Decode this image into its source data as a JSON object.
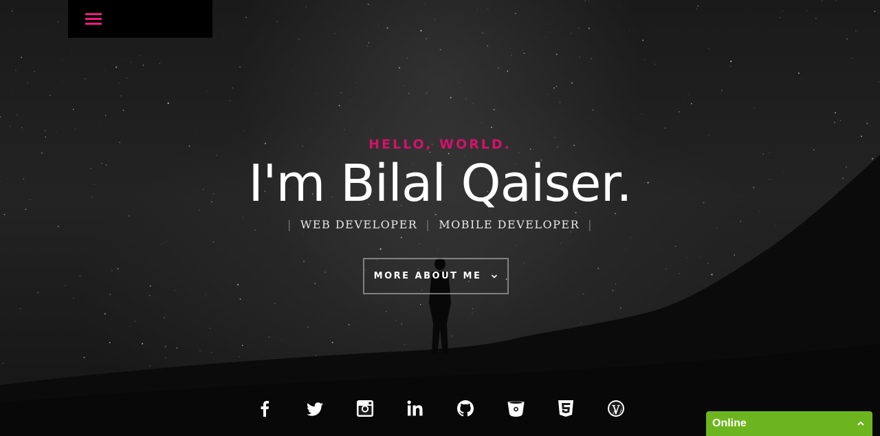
{
  "header": {
    "menu_icon": "hamburger-menu-icon",
    "accent_color": "#ee1a7c"
  },
  "hero": {
    "kicker": "HELLO, WORLD.",
    "headline": "I'm Bilal Qaiser.",
    "roles": [
      "WEB DEVELOPER",
      "MOBILE DEVELOPER"
    ],
    "roles_separator": "|",
    "cta_label": "MORE ABOUT ME",
    "cta_icon": "chevron-down-icon",
    "kicker_color": "#d4126a"
  },
  "social": {
    "icons": [
      "facebook-icon",
      "twitter-icon",
      "instagram-icon",
      "linkedin-icon",
      "github-icon",
      "bitbucket-icon",
      "html5-icon",
      "wordpress-icon"
    ]
  },
  "chat_widget": {
    "status_label": "Online",
    "toggle_icon": "chevron-up-icon",
    "color": "#6db51e"
  }
}
